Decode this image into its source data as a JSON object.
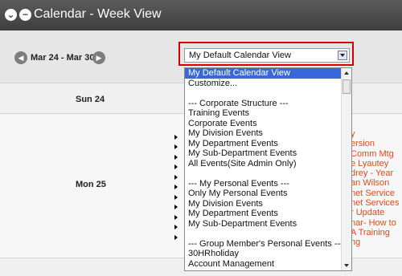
{
  "window": {
    "title": "Calendar - Week View"
  },
  "nav": {
    "date_range": "Mar 24 - Mar 30"
  },
  "view_select": {
    "selected": "My Default Calendar View",
    "options": [
      "My Default Calendar View",
      "Customize...",
      "",
      "--- Corporate Structure ---",
      "Training Events",
      "Corporate Events",
      "My Division Events",
      "My Department Events",
      "My Sub-Department Events",
      "All Events(Site Admin Only)",
      "",
      "--- My Personal Events ---",
      "Only My Personal Events",
      "My Division Events",
      "My Department Events",
      "My Sub-Department Events",
      "",
      "--- Group Member's Personal Events ---",
      "30HRholiday",
      "Account Management"
    ]
  },
  "days": [
    {
      "label": "Sun 24"
    },
    {
      "label": "Mon 25"
    }
  ],
  "events_partial": [
    "y",
    "ersion",
    "Comm Mtg",
    "e Lyautey",
    "drey - Year",
    "an Wilson",
    "net Service",
    "net Services",
    "r Update",
    "nar- How to",
    "A Training",
    "ng"
  ],
  "colors": {
    "title_bar": "#4a4a4a",
    "selected_option": "#3967d8",
    "event_text": "#e04a1a",
    "highlight_border": "#d40000"
  }
}
